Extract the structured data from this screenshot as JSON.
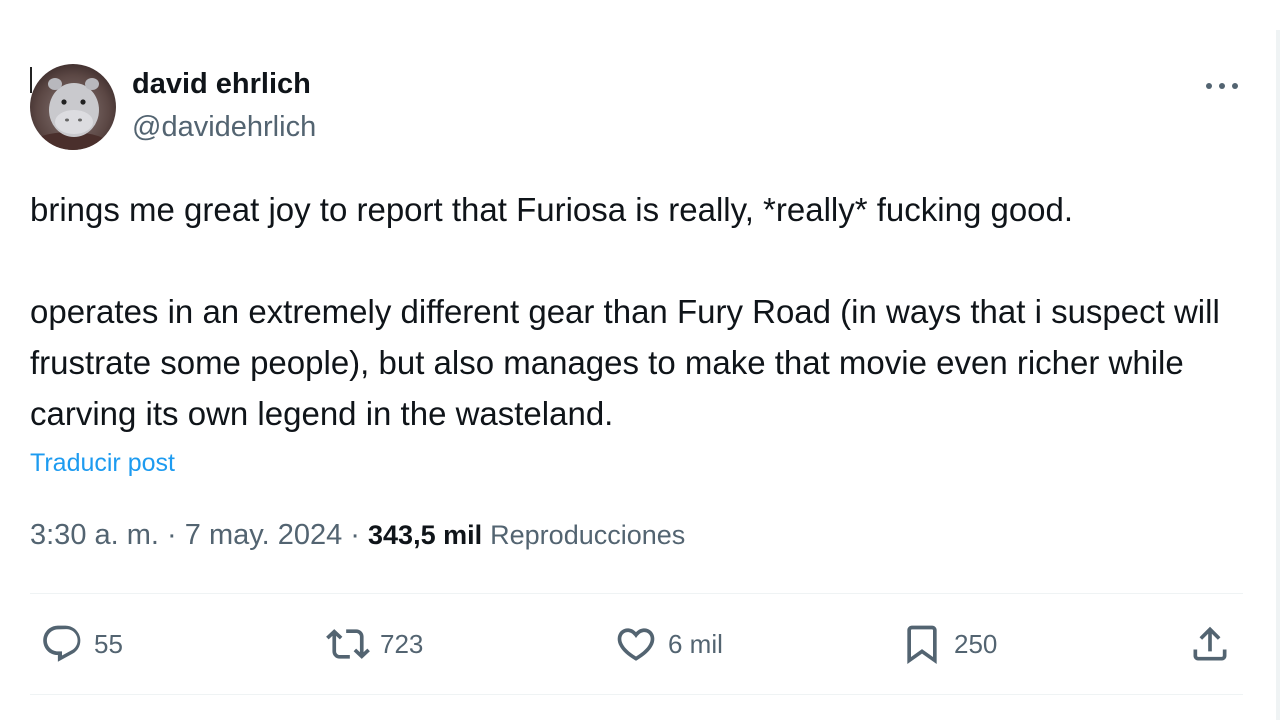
{
  "author": {
    "name": "david ehrlich",
    "handle": "@davidehrlich"
  },
  "post": {
    "paragraphs": [
      "brings me great joy to report that Furiosa is really, *really* fucking good.",
      "operates in an extremely different gear than Fury Road (in ways that i suspect will frustrate some people), but also manages to make that movie even richer while carving its own legend in the wasteland."
    ],
    "translate_label": "Traducir post"
  },
  "meta": {
    "time": "3:30 a. m.",
    "date": "7 may. 2024",
    "separator": "·",
    "views_count": "343,5 mil",
    "views_label": "Reproducciones"
  },
  "actions": {
    "replies": "55",
    "reposts": "723",
    "likes": "6 mil",
    "bookmarks": "250"
  },
  "icons": {
    "more": "more-horizontal-icon",
    "reply": "reply-icon",
    "repost": "repost-icon",
    "like": "heart-icon",
    "bookmark": "bookmark-icon",
    "share": "share-icon"
  },
  "colors": {
    "text": "#0f1419",
    "secondary": "#536471",
    "link": "#1d9bf0",
    "divider": "#eff3f4"
  }
}
